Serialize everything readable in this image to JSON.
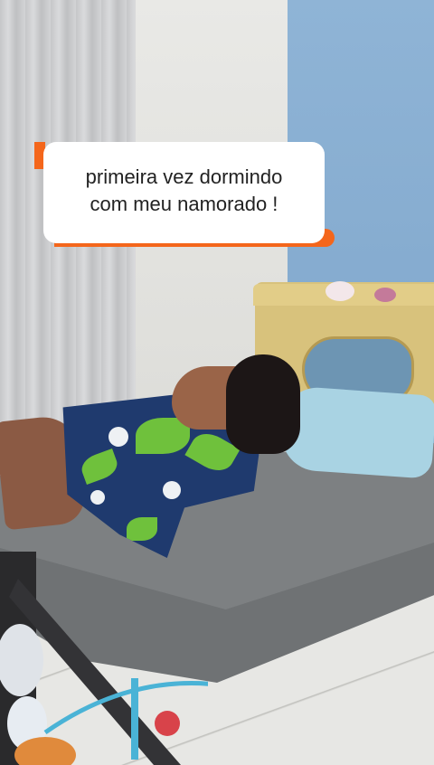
{
  "caption": {
    "line1": "primeira vez dormindo",
    "line2": "com meu namorado !",
    "accent_color": "#f4661b",
    "background_color": "#ffffff"
  },
  "scene": {
    "wall_colors": {
      "left": "#e9e9e6",
      "right": "#8fb4d6"
    },
    "bed_color": "#7d8082",
    "pillow_color": "#a9d3e3",
    "dress_colors": [
      "#1f3a6e",
      "#6fc13c",
      "#eef1f4"
    ]
  }
}
